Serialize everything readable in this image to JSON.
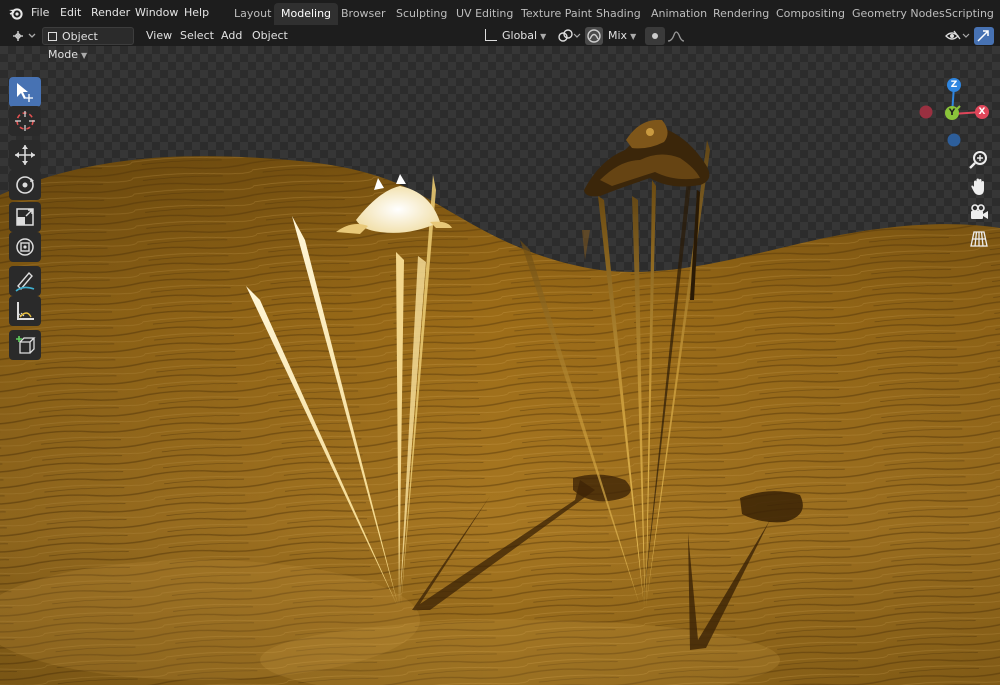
{
  "menu": {
    "items": [
      "File",
      "Edit",
      "Render",
      "Window",
      "Help"
    ]
  },
  "workspaces": {
    "tabs": [
      "Layout",
      "Modeling",
      "Browser",
      "Sculpting",
      "UV Editing",
      "Texture Paint",
      "Shading",
      "Animation",
      "Rendering",
      "Compositing",
      "Geometry Nodes",
      "Scripting"
    ],
    "active": "Modeling"
  },
  "header": {
    "mode": "Object Mode",
    "menus": [
      "View",
      "Select",
      "Add",
      "Object"
    ],
    "transform_orientation": "Global",
    "proportional_falloff": "Mix"
  },
  "gizmo": {
    "z_label": "Z",
    "y_label": "Y",
    "x_label": "X"
  },
  "toolbar": {
    "tools": [
      "select-box",
      "cursor",
      "move",
      "rotate",
      "scale",
      "transform",
      "annotate",
      "measure",
      "add-cube"
    ],
    "active": "select-box"
  },
  "colors": {
    "accent": "#4772b3",
    "axis_x": "#e0465a",
    "axis_y": "#8ac43a",
    "axis_z": "#2f86e0",
    "ground": "#a8761c"
  }
}
